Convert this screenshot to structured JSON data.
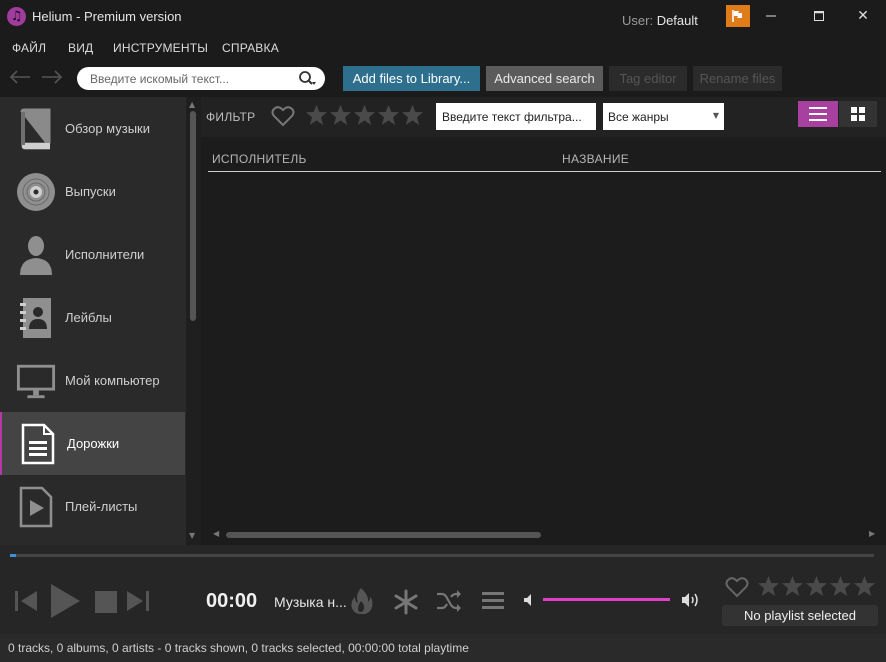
{
  "window": {
    "title": "Helium - Premium version",
    "user_label": "User:",
    "user_name": "Default",
    "minimize_symbol": "—",
    "maximize_symbol": "☐",
    "close_symbol": "✕"
  },
  "menu": {
    "items": [
      "ФАЙЛ",
      "ВИД",
      "ИНСТРУМЕНТЫ",
      "СПРАВКА"
    ]
  },
  "toolbar": {
    "back_icon": "arrow-left-icon",
    "forward_icon": "arrow-right-icon",
    "search_placeholder": "Введите искомый текст...",
    "search_value": "",
    "buttons": {
      "add_files": "Add files to Library...",
      "advanced_search": "Advanced search",
      "tag_editor": "Tag editor",
      "rename_files": "Rename files"
    },
    "disabled_buttons": [
      "tag_editor",
      "rename_files"
    ]
  },
  "sidebar": {
    "items": [
      {
        "label": "Обзор музыки",
        "icon": "book-icon",
        "active": false
      },
      {
        "label": "Выпуски",
        "icon": "disc-icon",
        "active": false
      },
      {
        "label": "Исполнители",
        "icon": "person-icon",
        "active": false
      },
      {
        "label": "Лейблы",
        "icon": "address-book-icon",
        "active": false
      },
      {
        "label": "Мой компьютер",
        "icon": "monitor-icon",
        "active": false
      },
      {
        "label": "Дорожки",
        "icon": "document-icon",
        "active": true
      },
      {
        "label": "Плей-листы",
        "icon": "playlist-icon",
        "active": false
      }
    ]
  },
  "filter": {
    "label": "ФИЛЬТР",
    "text_placeholder": "Введите текст фильтра...",
    "genre_selected": "Все жанры",
    "rating_stars": 5,
    "view_mode": "list"
  },
  "table": {
    "columns": [
      "ИСПОЛНИТЕЛЬ",
      "НАЗВАНИЕ"
    ],
    "rows": []
  },
  "player": {
    "time": "00:00",
    "track_title": "Музыка н...",
    "progress": 0.007,
    "volume": 1.0,
    "rating_stars": 5,
    "playlist_status": "No playlist selected"
  },
  "status": {
    "text": "0 tracks, 0 albums, 0 artists - 0 tracks shown, 0 tracks selected, 00:00:00 total playtime"
  },
  "colors": {
    "accent": "#a8409f",
    "volume_fill": "#e040c8",
    "progress_fill": "#3c8fd9",
    "add_button": "#2e6f8e",
    "flag": "#e07b1a"
  }
}
